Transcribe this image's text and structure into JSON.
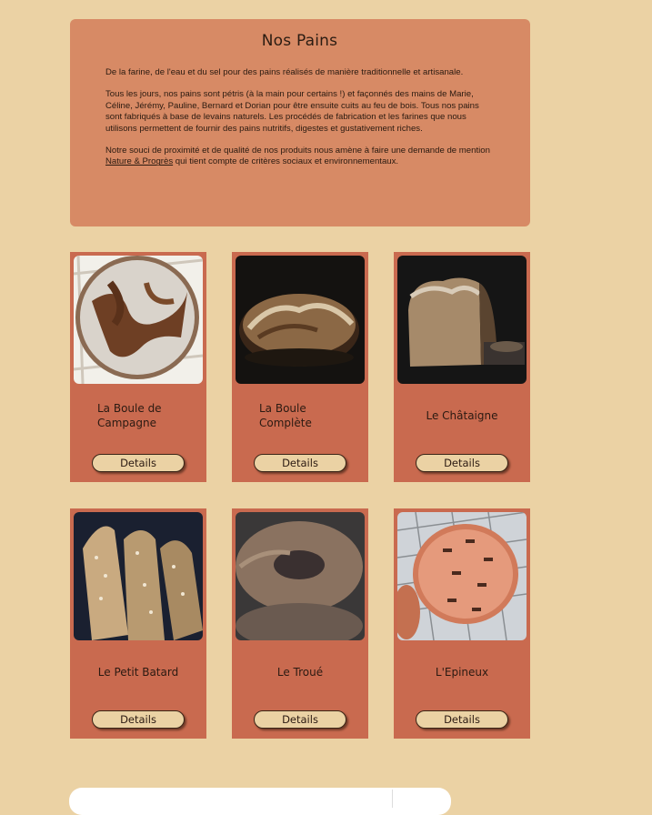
{
  "intro": {
    "title": "Nos Pains",
    "p1": "De la farine, de l'eau et du sel pour des pains réalisés de manière traditionnelle et artisanale.",
    "p2": "Tous les jours, nos pains sont pétris (à la main pour certains !) et  façonnés des mains de Marie, Céline, Jérémy, Pauline, Bernard et Dorian pour être ensuite cuits  au feu de bois. Tous nos pains sont fabriqués à base de levains naturels. Les procédés de fabrication et les farines que nous utilisons  permettent de fournir des pains nutritifs, digestes et gustativement  riches.",
    "p3_before": "Notre souci de proximité et de qualité de nos produits nous amène à faire une demande de mention ",
    "p3_link": "Nature & Progrès",
    "p3_after": " qui tient compte de critères sociaux et environnementaux."
  },
  "products": [
    {
      "name": "La Boule de Campagne",
      "button": "Details"
    },
    {
      "name": "La Boule Complète",
      "button": "Details"
    },
    {
      "name": "Le Châtaigne",
      "button": "Details"
    },
    {
      "name": "Le Petit Batard",
      "button": "Details"
    },
    {
      "name": "Le Troué",
      "button": "Details"
    },
    {
      "name": "L'Epineux",
      "button": "Details"
    }
  ]
}
